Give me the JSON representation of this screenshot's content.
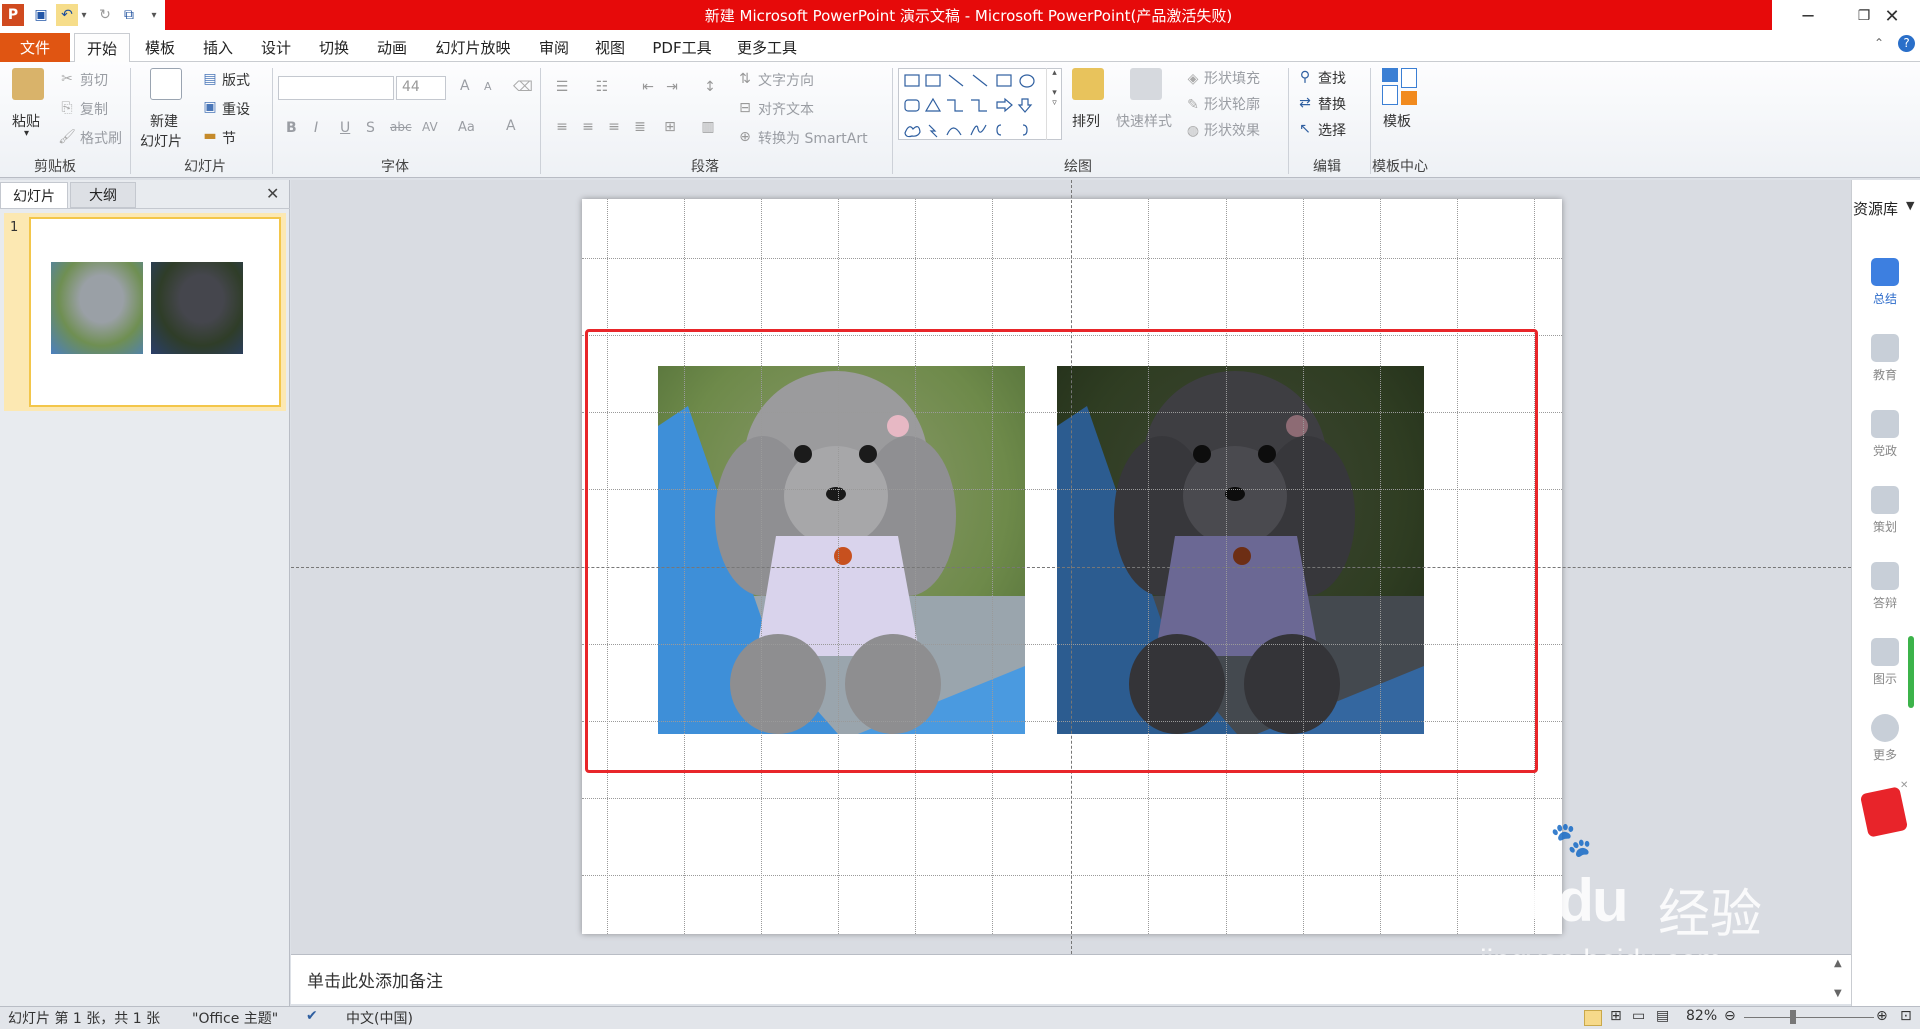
{
  "window": {
    "title": "新建 Microsoft PowerPoint 演示文稿 - Microsoft PowerPoint(产品激活失败)",
    "app_letter": "P"
  },
  "tabs": [
    "文件",
    "开始",
    "模板",
    "插入",
    "设计",
    "切换",
    "动画",
    "幻灯片放映",
    "审阅",
    "视图",
    "PDF工具",
    "更多工具"
  ],
  "ribbon": {
    "clipboard": {
      "paste": "粘贴",
      "cut": "剪切",
      "copy": "复制",
      "format_painter": "格式刷",
      "label": "剪贴板"
    },
    "slides": {
      "new_slide_1": "新建",
      "new_slide_2": "幻灯片",
      "layout": "版式",
      "reset": "重设",
      "section": "节",
      "label": "幻灯片"
    },
    "font": {
      "size": "44",
      "label": "字体",
      "bold": "B",
      "italic": "I",
      "underline": "U",
      "shadow": "S",
      "strike": "abc",
      "spacing": "AV",
      "case": "Aa",
      "color": "A",
      "grow": "A",
      "shrink": "A"
    },
    "paragraph": {
      "text_direction": "文字方向",
      "align_text": "对齐文本",
      "convert_smartart": "转换为 SmartArt",
      "label": "段落"
    },
    "drawing": {
      "arrange": "排列",
      "quick_styles": "快速样式",
      "shape_fill": "形状填充",
      "shape_outline": "形状轮廓",
      "shape_effects": "形状效果",
      "label": "绘图"
    },
    "editing": {
      "find": "查找",
      "replace": "替换",
      "select": "选择",
      "label": "编辑"
    },
    "template": {
      "label_btn": "模板",
      "label": "模板中心"
    }
  },
  "left_pane": {
    "tab_slides": "幻灯片",
    "tab_outline": "大纲",
    "slide_number": "1"
  },
  "notes": {
    "placeholder": "单击此处添加备注"
  },
  "right_panel": {
    "title": "资源库",
    "items": [
      "总结",
      "教育",
      "党政",
      "策划",
      "答辩",
      "图示",
      "更多"
    ]
  },
  "status": {
    "slide_info": "幻灯片 第 1 张，共 1 张",
    "theme": "\"Office 主题\"",
    "language": "中文(中国)",
    "zoom": "82%"
  },
  "watermark": {
    "brand": "Bai",
    "brand2": "du",
    "cn": "经验",
    "url": "jingyan.baidu.com"
  },
  "colors": {
    "title_band": "#e60a0a",
    "file_tab": "#e05512",
    "selection": "#e8262a"
  }
}
